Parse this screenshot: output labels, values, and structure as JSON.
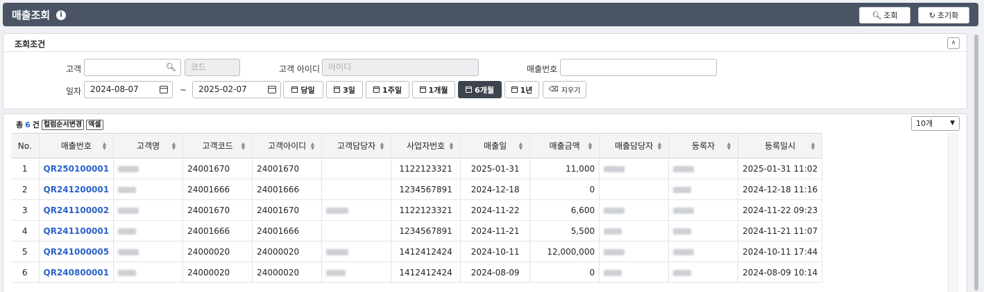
{
  "header": {
    "title": "매출조회",
    "search_label": "조회",
    "reset_label": "초기화"
  },
  "conditions": {
    "title": "조회조건",
    "customer_label": "고객",
    "code_placeholder": "코드",
    "customer_id_label": "고객 아이디",
    "customer_id_placeholder": "아이디",
    "sales_no_label": "매출번호",
    "date_label": "일자",
    "date_from": "2024-08-07",
    "date_to": "2025-02-07",
    "range_sep": "~",
    "quick": [
      "당일",
      "3일",
      "1주일",
      "1개월",
      "6개월",
      "1년"
    ],
    "clear_label": "지우기"
  },
  "grid": {
    "total_prefix": "총",
    "total_count": "6",
    "total_suffix": "건",
    "column_order_label": "컬럼순서변경",
    "excel_label": "엑셀",
    "page_size": "10개",
    "columns": [
      "No.",
      "매출번호",
      "고객명",
      "고객코드",
      "고객아이디",
      "고객담당자",
      "사업자번호",
      "매출일",
      "매출금액",
      "매출담당자",
      "등록자",
      "등록일시"
    ],
    "rows": [
      [
        "1",
        "QR250100001",
        "",
        "24001670",
        "24001670",
        "",
        "1122123321",
        "2025-01-31",
        "11,000",
        "",
        "",
        "2025-01-31 11:02"
      ],
      [
        "2",
        "QR241200001",
        "",
        "24001666",
        "24001666",
        "",
        "1234567891",
        "2024-12-18",
        "0",
        "",
        "",
        "2024-12-18 11:16"
      ],
      [
        "3",
        "QR241100002",
        "",
        "24001670",
        "24001670",
        "",
        "1122123321",
        "2024-11-22",
        "6,600",
        "",
        "",
        "2024-11-22 09:23"
      ],
      [
        "4",
        "QR241100001",
        "",
        "24001666",
        "24001666",
        "",
        "1234567891",
        "2024-11-21",
        "5,500",
        "",
        "",
        "2024-11-21 11:07"
      ],
      [
        "5",
        "QR241000005",
        "",
        "24000020",
        "24000020",
        "",
        "1412412424",
        "2024-10-11",
        "12,000,000",
        "",
        "",
        "2024-10-11 17:44"
      ],
      [
        "6",
        "QR240800001",
        "",
        "24000020",
        "24000020",
        "",
        "1412412424",
        "2024-08-09",
        "0",
        "",
        "",
        "2024-08-09 10:14"
      ]
    ]
  }
}
